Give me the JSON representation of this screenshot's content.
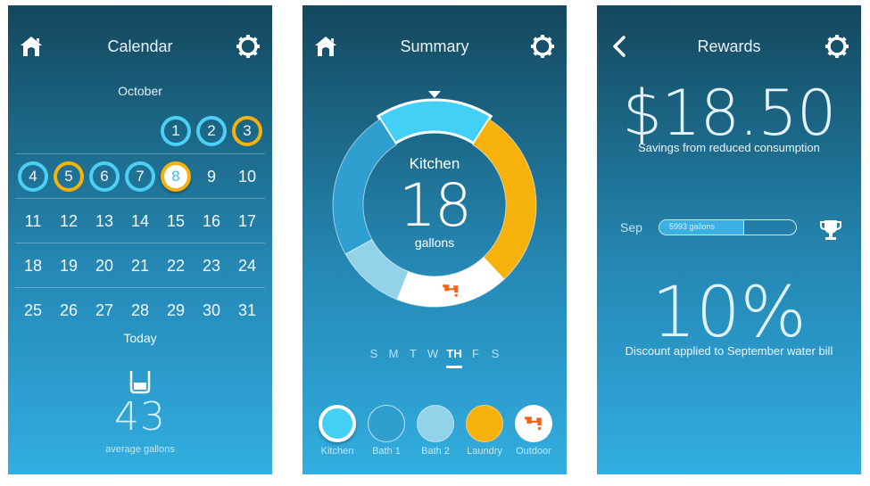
{
  "colors": {
    "kitchen": "#43d0f7",
    "bath1": "#2f9fd0",
    "bath2": "#93d3ea",
    "laundry": "#f6b10b",
    "outdoor": "#ffffff",
    "outdoor_icon": "#f2641c",
    "ring_blue": "#4dcff5",
    "ring_gold": "#f6b10b"
  },
  "calendar_screen": {
    "title": "Calendar",
    "left_icon": "home-icon",
    "right_icon": "gear-icon",
    "month": "October",
    "weeks": [
      [
        {
          "day": "",
          "status": "none"
        },
        {
          "day": "",
          "status": "none"
        },
        {
          "day": "",
          "status": "none"
        },
        {
          "day": "",
          "status": "none"
        },
        {
          "day": "1",
          "status": "blue"
        },
        {
          "day": "2",
          "status": "blue"
        },
        {
          "day": "3",
          "status": "gold"
        }
      ],
      [
        {
          "day": "4",
          "status": "blue"
        },
        {
          "day": "5",
          "status": "gold"
        },
        {
          "day": "6",
          "status": "blue"
        },
        {
          "day": "7",
          "status": "blue"
        },
        {
          "day": "8",
          "status": "today"
        },
        {
          "day": "9",
          "status": "none"
        },
        {
          "day": "10",
          "status": "none"
        }
      ],
      [
        {
          "day": "11",
          "status": "none"
        },
        {
          "day": "12",
          "status": "none"
        },
        {
          "day": "13",
          "status": "none"
        },
        {
          "day": "14",
          "status": "none"
        },
        {
          "day": "15",
          "status": "none"
        },
        {
          "day": "16",
          "status": "none"
        },
        {
          "day": "17",
          "status": "none"
        }
      ],
      [
        {
          "day": "18",
          "status": "none"
        },
        {
          "day": "19",
          "status": "none"
        },
        {
          "day": "20",
          "status": "none"
        },
        {
          "day": "21",
          "status": "none"
        },
        {
          "day": "22",
          "status": "none"
        },
        {
          "day": "23",
          "status": "none"
        },
        {
          "day": "24",
          "status": "none"
        }
      ],
      [
        {
          "day": "25",
          "status": "none"
        },
        {
          "day": "26",
          "status": "none"
        },
        {
          "day": "27",
          "status": "none"
        },
        {
          "day": "28",
          "status": "none"
        },
        {
          "day": "29",
          "status": "none"
        },
        {
          "day": "30",
          "status": "none"
        },
        {
          "day": "31",
          "status": "none"
        }
      ]
    ],
    "today_label": "Today",
    "today_icon": "water-glass-icon",
    "average_value": "43",
    "average_label": "average gallons"
  },
  "summary_screen": {
    "title": "Summary",
    "left_icon": "home-icon",
    "right_icon": "gear-icon",
    "selected_label": "Kitchen",
    "selected_value": "18",
    "selected_unit": "gallons",
    "segments": [
      {
        "name": "Kitchen",
        "share": 0.18,
        "color_key": "kitchen",
        "selected": true
      },
      {
        "name": "Laundry",
        "share": 0.29,
        "color_key": "laundry",
        "selected": false
      },
      {
        "name": "Outdoor",
        "share": 0.18,
        "color_key": "outdoor",
        "selected": false
      },
      {
        "name": "Bath 2",
        "share": 0.11,
        "color_key": "bath2",
        "selected": false
      },
      {
        "name": "Bath 1",
        "share": 0.24,
        "color_key": "bath1",
        "selected": false
      }
    ],
    "days": [
      {
        "label": "S",
        "active": false
      },
      {
        "label": "M",
        "active": false
      },
      {
        "label": "T",
        "active": false
      },
      {
        "label": "W",
        "active": false
      },
      {
        "label": "TH",
        "active": true
      },
      {
        "label": "F",
        "active": false
      },
      {
        "label": "S",
        "active": false
      }
    ],
    "legend": [
      {
        "label": "Kitchen",
        "color_key": "kitchen",
        "style": "selected"
      },
      {
        "label": "Bath 1",
        "color_key": "bath1",
        "style": "outline"
      },
      {
        "label": "Bath 2",
        "color_key": "bath2",
        "style": "fill"
      },
      {
        "label": "Laundry",
        "color_key": "laundry",
        "style": "fill"
      },
      {
        "label": "Outdoor",
        "color_key": "outdoor",
        "style": "icon"
      }
    ],
    "outdoor_icon": "faucet-icon"
  },
  "rewards_screen": {
    "title": "Rewards",
    "left_icon": "back-chevron-icon",
    "right_icon": "gear-icon",
    "savings_amount": "$18.50",
    "savings_label": "Savings from reduced consumption",
    "progress_month": "Sep",
    "progress_text": "5993 gallons",
    "progress_fraction": 0.62,
    "trophy_icon": "trophy-icon",
    "discount_value": "10%",
    "discount_label": "Discount applied to September water bill"
  }
}
